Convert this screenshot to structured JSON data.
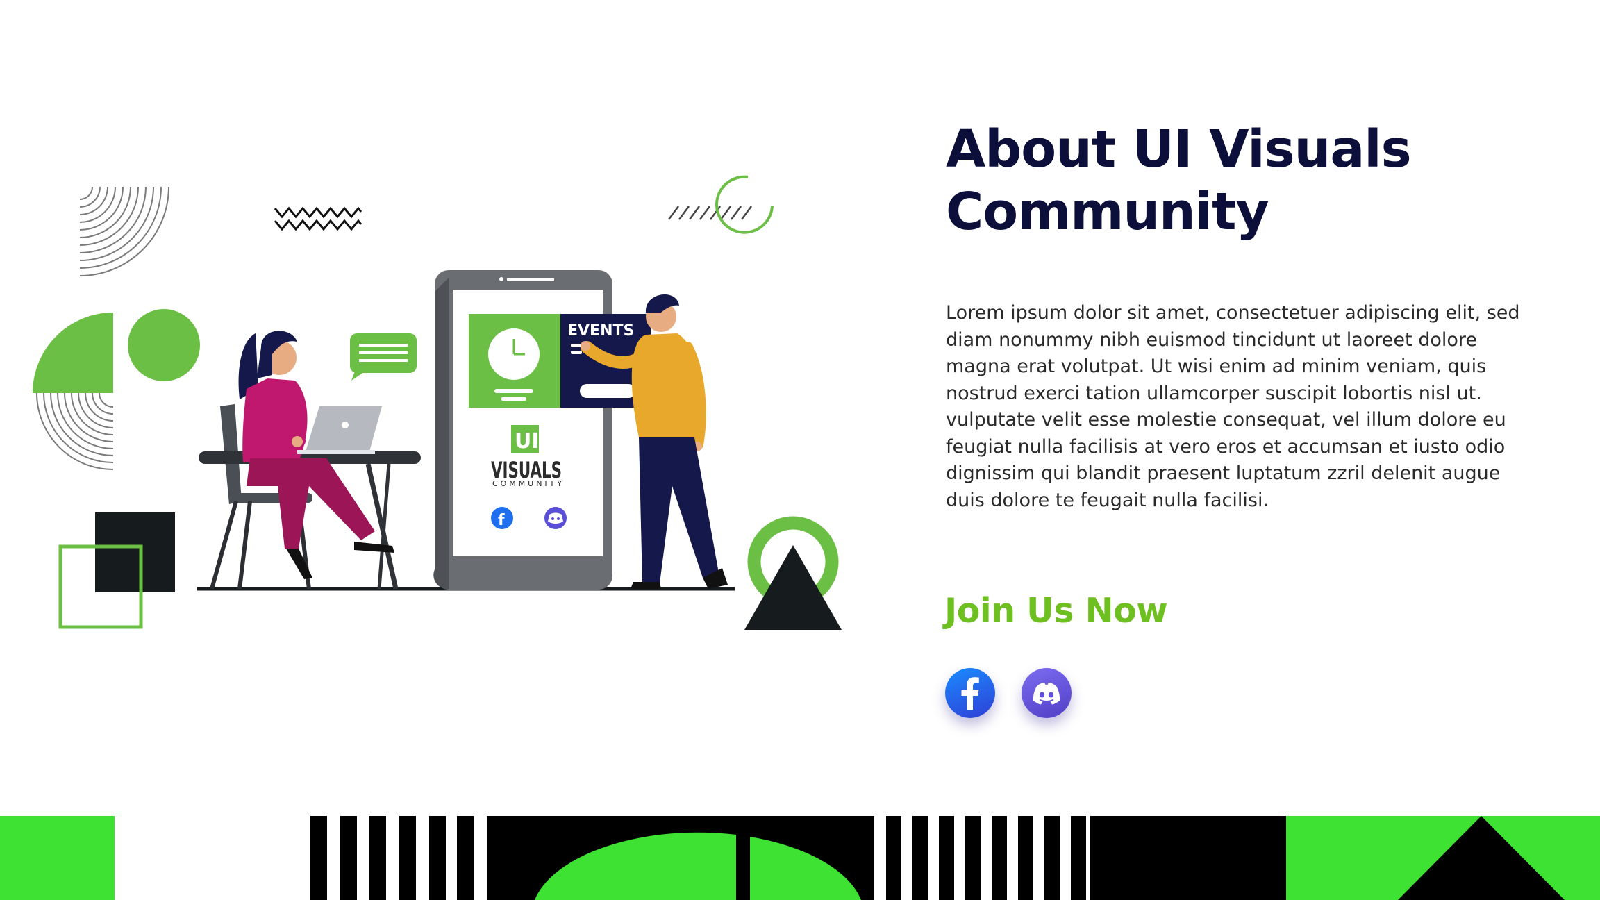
{
  "colors": {
    "title": "#0c0f3a",
    "accent_green": "#6ec020",
    "bright_green": "#3ee232",
    "illustration_green": "#6cbf45",
    "dark": "#161b1e",
    "body_text": "#2a2a2a",
    "facebook": "#1877f2",
    "discord": "#5865f2"
  },
  "illustration": {
    "phone_tile_label": "EVENTS",
    "logo_ui": "UI",
    "logo_main": "VISUALS",
    "logo_sub": "COMMUNITY"
  },
  "about": {
    "title": "About UI Visuals Community",
    "paragraph_1": "Lorem ipsum dolor sit amet, consectetuer adipiscing elit, sed diam nonummy nibh euismod tincidunt ut laoreet dolore magna erat volutpat. Ut wisi enim ad minim veniam, quis nostrud exerci tation ullamcorper suscipit lobortis nisl ut.",
    "paragraph_2": "vulputate velit esse molestie consequat, vel illum dolore eu feugiat nulla facilisis at vero eros et accumsan et iusto odio dignissim qui blandit praesent luptatum zzril delenit augue duis dolore te feugait nulla facilisi."
  },
  "join": {
    "label": "Join Us Now",
    "social": [
      {
        "name": "Facebook",
        "icon": "facebook-icon"
      },
      {
        "name": "Discord",
        "icon": "discord-icon"
      }
    ]
  }
}
